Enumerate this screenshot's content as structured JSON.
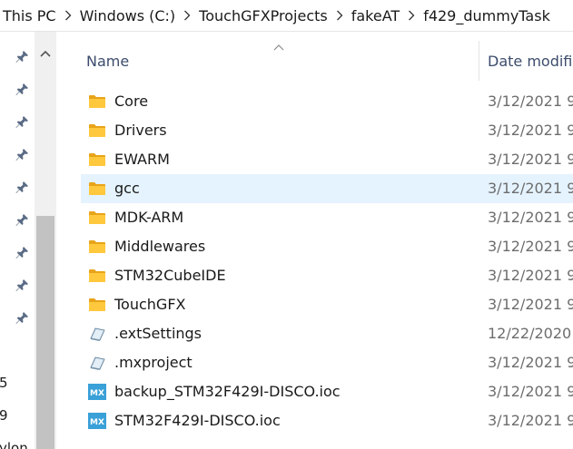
{
  "breadcrumb": [
    "This PC",
    "Windows (C:)",
    "TouchGFXProjects",
    "fakeAT",
    "f429_dummyTask"
  ],
  "columns": {
    "name": "Name",
    "date": "Date modifi"
  },
  "nav": {
    "truncated_labels": [
      "5",
      "9",
      "ylon"
    ]
  },
  "files": [
    {
      "name": "Core",
      "date": "3/12/2021 9",
      "type": "folder",
      "selected": false
    },
    {
      "name": "Drivers",
      "date": "3/12/2021 9",
      "type": "folder",
      "selected": false
    },
    {
      "name": "EWARM",
      "date": "3/12/2021 9",
      "type": "folder",
      "selected": false
    },
    {
      "name": "gcc",
      "date": "3/12/2021 9",
      "type": "folder",
      "selected": true
    },
    {
      "name": "MDK-ARM",
      "date": "3/12/2021 9",
      "type": "folder",
      "selected": false
    },
    {
      "name": "Middlewares",
      "date": "3/12/2021 9",
      "type": "folder",
      "selected": false
    },
    {
      "name": "STM32CubeIDE",
      "date": "3/12/2021 9",
      "type": "folder",
      "selected": false
    },
    {
      "name": "TouchGFX",
      "date": "3/12/2021 9",
      "type": "folder",
      "selected": false
    },
    {
      "name": ".extSettings",
      "date": "12/22/2020",
      "type": "generic-file",
      "selected": false
    },
    {
      "name": ".mxproject",
      "date": "3/12/2021 9",
      "type": "generic-file",
      "selected": false
    },
    {
      "name": "backup_STM32F429I-DISCO.ioc",
      "date": "3/12/2021 9",
      "type": "mx-file",
      "selected": false
    },
    {
      "name": "STM32F429I-DISCO.ioc",
      "date": "3/12/2021 9",
      "type": "mx-file",
      "selected": false
    }
  ],
  "icons": {
    "folder": "folder-icon",
    "generic-file": "generic-file-icon",
    "mx-file": "stm32cubemx-file-icon",
    "pin": "pin-icon",
    "sort": "sort-ascending-icon",
    "separator": "chevron-right-icon",
    "scroll-up": "chevron-up-icon"
  },
  "colors": {
    "selected_row": "#e5f3ff",
    "folder_yellow": "#ffc83d",
    "mx_badge": "#39a0d8",
    "header_text": "#3c4c6c",
    "date_text": "#6d6d6d"
  },
  "mx_badge_label": "MX"
}
